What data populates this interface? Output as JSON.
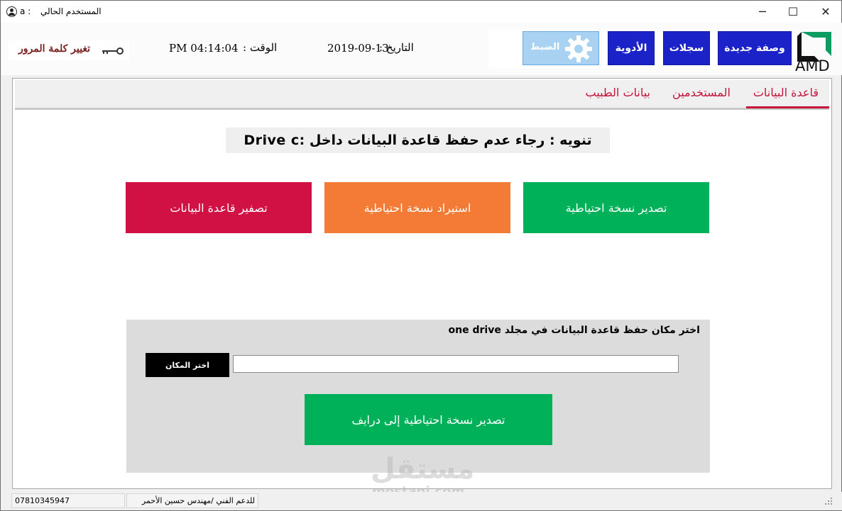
{
  "window": {
    "title_label": "المستخدم الحالي",
    "user": "a :",
    "minimize_glyph": "─",
    "maximize_glyph": "☐",
    "close_glyph": "✕"
  },
  "header": {
    "change_password": "تغيير كلمة المرور",
    "time_label": "الوقت :",
    "time_value": "PM 04:14:04",
    "date_label": "التاريخ :",
    "date_value": "2019-09-13",
    "buttons": {
      "new_prescription": "وصفة جديدة",
      "records": "سجلات",
      "medicines": "الأدوية",
      "settings": "الضبط"
    },
    "logo_text": "AMD"
  },
  "tabs": [
    {
      "label": "قاعدة البيانات",
      "active": true
    },
    {
      "label": "المستخدمين",
      "active": false
    },
    {
      "label": "بيانات الطبيب",
      "active": false
    }
  ],
  "notice": "تنويه : رجاء عدم حفظ قاعدة البيانات داخل :Drive c",
  "actions": {
    "export_backup": "تصدير نسخة احتياطية",
    "import_backup": "استيراد نسخة احتياطية",
    "reset_database": "تصفير قاعدة البيانات"
  },
  "cloud": {
    "title": "اختر مكان حفظ قاعدة البيانات  في مجلد  one drive",
    "choose_location": "اختر المكان",
    "path_value": "",
    "export_to_drive": "تصدير نسخة احتياطية  إلى درايف"
  },
  "watermark": {
    "main": "مستقل",
    "sub": "mostaqi.com"
  },
  "status": {
    "phone": "07810345947",
    "support": "للدعم الفني /مهندس حسين الأحمر"
  },
  "colors": {
    "primary_blue": "#1a22c8",
    "settings_blue": "#a8d1f2",
    "tab_red": "#c4143a",
    "export_green": "#00b15a",
    "import_orange": "#f47b36",
    "reset_red": "#d11044"
  },
  "icons": {
    "user": "user-circle-icon",
    "key": "key-icon",
    "gear": "gear-icon",
    "logo": "amd-logo-icon",
    "grip": "resize-grip-icon"
  }
}
